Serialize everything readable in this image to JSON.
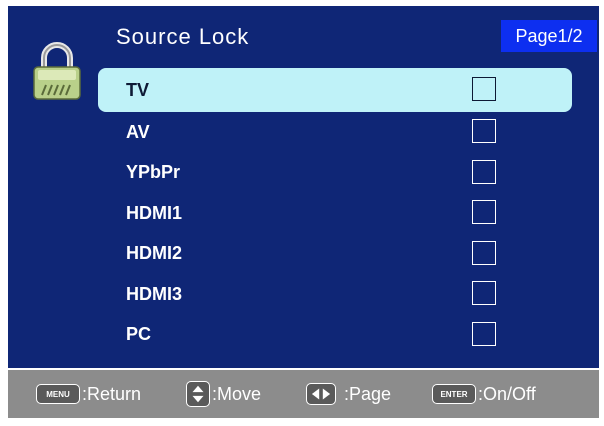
{
  "header": {
    "title": "Source Lock",
    "page": "Page1/2"
  },
  "sources": [
    {
      "label": "TV",
      "selected": true,
      "checked": false
    },
    {
      "label": "AV",
      "selected": false,
      "checked": false
    },
    {
      "label": "YPbPr",
      "selected": false,
      "checked": false
    },
    {
      "label": "HDMI1",
      "selected": false,
      "checked": false
    },
    {
      "label": "HDMI2",
      "selected": false,
      "checked": false
    },
    {
      "label": "HDMI3",
      "selected": false,
      "checked": false
    },
    {
      "label": "PC",
      "selected": false,
      "checked": false
    }
  ],
  "footer": {
    "menu_key": "MENU",
    "return_label": ":Return",
    "move_label": ":Move",
    "page_label": ":Page",
    "enter_key": "ENTER",
    "onoff_label": ":On/Off"
  },
  "icons": {
    "lock": "padlock-icon",
    "move": "up-down-arrows-icon",
    "page": "left-right-arrows-icon"
  },
  "colors": {
    "background": "#0f2676",
    "highlight": "#bff2f8",
    "page_badge": "#0d2ff0",
    "footer": "#8c8c8c"
  }
}
